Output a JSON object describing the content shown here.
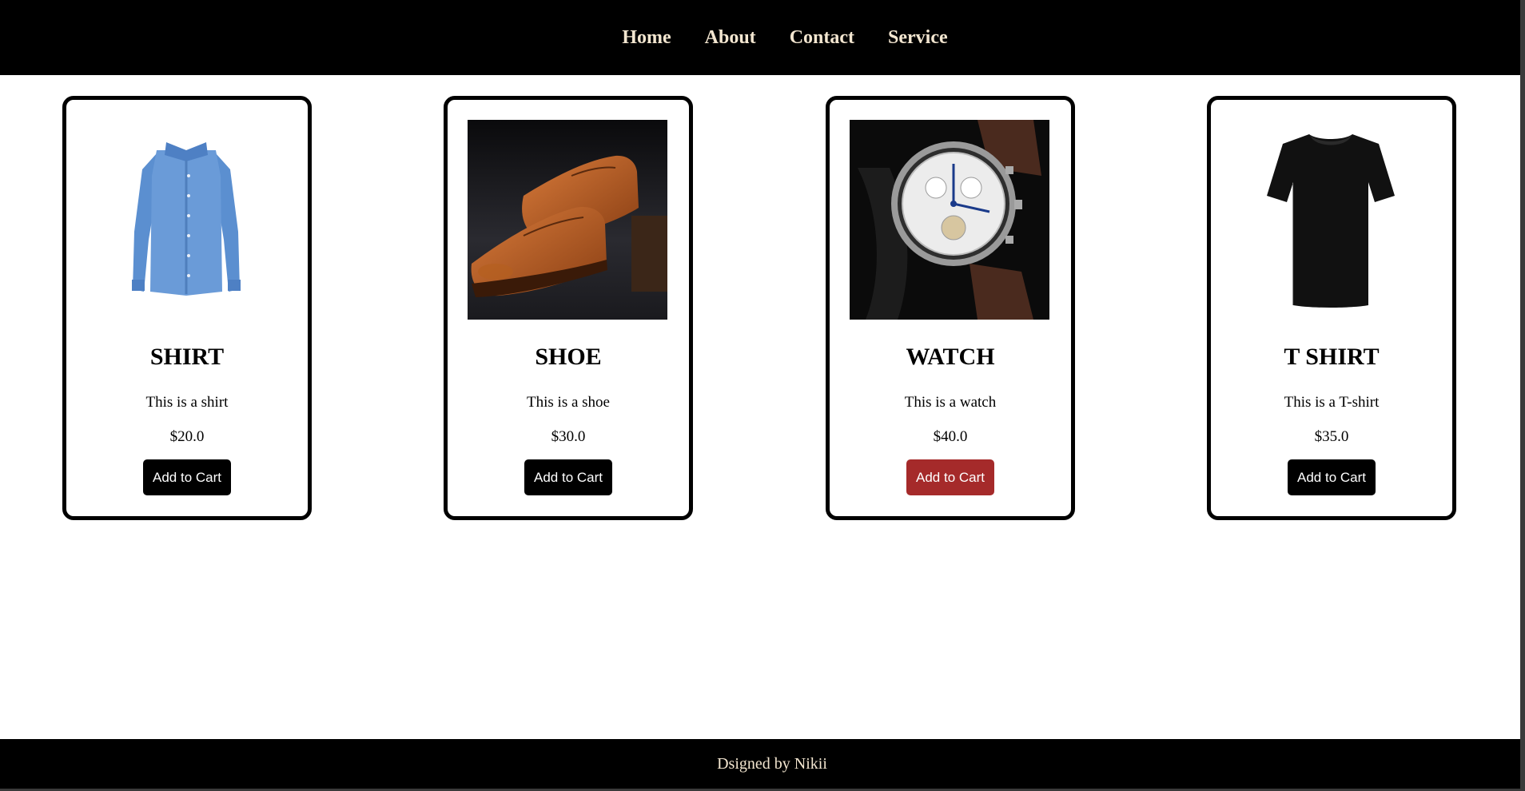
{
  "nav": {
    "links": [
      "Home",
      "About",
      "Contact",
      "Service"
    ]
  },
  "products": [
    {
      "title": "SHIRT",
      "description": "This is a shirt",
      "price": "$20.0",
      "button": "Add to Cart",
      "image": "blue-shirt-image"
    },
    {
      "title": "SHOE",
      "description": "This is a shoe",
      "price": "$30.0",
      "button": "Add to Cart",
      "image": "brown-shoe-image"
    },
    {
      "title": "WATCH",
      "description": "This is a watch",
      "price": "$40.0",
      "button": "Add to Cart",
      "image": "watch-image"
    },
    {
      "title": "T SHIRT",
      "description": "This is a T-shirt",
      "price": "$35.0",
      "button": "Add to Cart",
      "image": "black-tshirt-image"
    }
  ],
  "footer": {
    "text": "Dsigned by Nikii"
  },
  "colors": {
    "nav_bg": "#000000",
    "nav_text": "#f3e6d0",
    "button_bg": "#000000",
    "button_hover_bg": "#a52a2a"
  }
}
